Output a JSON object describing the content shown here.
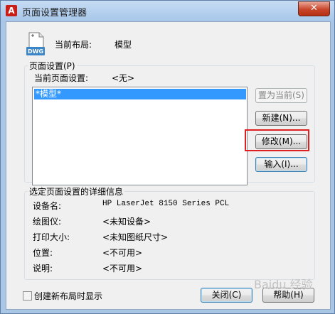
{
  "window": {
    "title": "页面设置管理器",
    "close": "✕"
  },
  "current_layout": {
    "label": "当前布局:",
    "value": "模型"
  },
  "page_setup_group": {
    "title": "页面设置(P)",
    "current_label": "当前页面设置:",
    "current_value": "<无>",
    "list_items": [
      "*模型*"
    ]
  },
  "buttons": {
    "set_current": "置为当前(S)",
    "new": "新建(N)...",
    "modify": "修改(M)...",
    "import": "输入(I)...",
    "close": "关闭(C)",
    "help": "帮助(H)"
  },
  "details_group": {
    "title": "选定页面设置的详细信息",
    "rows": [
      {
        "label": "设备名:",
        "value": "HP LaserJet 8150 Series PCL"
      },
      {
        "label": "绘图仪:",
        "value": "<未知设备>"
      },
      {
        "label": "打印大小:",
        "value": "<未知图纸尺寸>"
      },
      {
        "label": "位置:",
        "value": "<不可用>"
      },
      {
        "label": "说明:",
        "value": "<不可用>"
      }
    ]
  },
  "checkbox": {
    "label": "创建新布局时显示",
    "checked": false
  },
  "icon": {
    "name": "dwg-file-icon",
    "text": "DWG"
  },
  "watermark": "Baidu 经验"
}
